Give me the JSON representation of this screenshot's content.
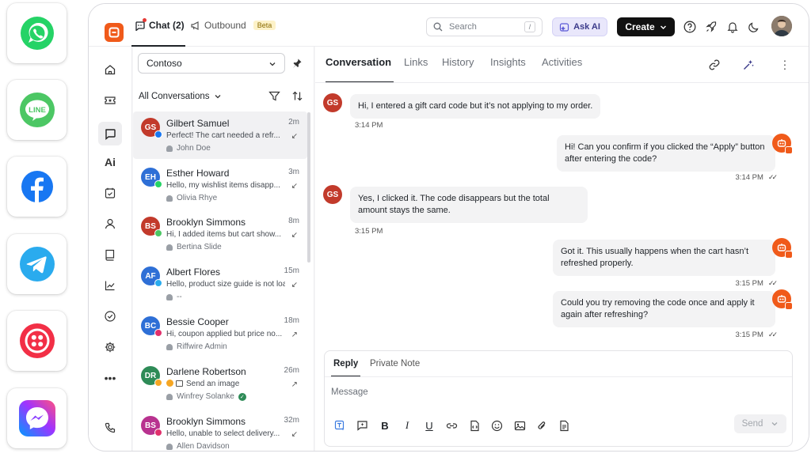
{
  "channels": [
    {
      "name": "WhatsApp",
      "icon": "whatsapp-icon",
      "color": "#25D366"
    },
    {
      "name": "LINE",
      "icon": "line-icon",
      "color": "#4CC764",
      "text": "LINE"
    },
    {
      "name": "Facebook",
      "icon": "facebook-icon",
      "color": "#1877F2"
    },
    {
      "name": "Telegram",
      "icon": "telegram-icon",
      "color": "#2AABEE"
    },
    {
      "name": "Twilio",
      "icon": "twilio-icon",
      "color": "#F22F46"
    },
    {
      "name": "Messenger",
      "icon": "messenger-icon",
      "color": "#A334FA"
    }
  ],
  "header": {
    "chat_tab": "Chat (2)",
    "outbound_tab": "Outbound",
    "beta_badge": "Beta",
    "search_placeholder": "Search",
    "search_shortcut": "/",
    "ask_ai": "Ask AI",
    "create": "Create"
  },
  "inbox": {
    "workspace": "Contoso",
    "filter": "All Conversations",
    "conversations": [
      {
        "initials": "GS",
        "name": "Gilbert Samuel",
        "time": "2m",
        "preview": "Perfect! The cart needed a refr...",
        "agent": "John Doe",
        "color": "#c23a2b",
        "channel_color": "#1877F2",
        "selected": true
      },
      {
        "initials": "EH",
        "name": "Esther Howard",
        "time": "3m",
        "preview": "Hello, my wishlist items disapp...",
        "agent": "Olivia Rhye",
        "color": "#2e6fd6",
        "channel_color": "#25D366"
      },
      {
        "initials": "BS",
        "name": "Brooklyn Simmons",
        "time": "8m",
        "preview": "Hi, I added items but cart show...",
        "agent": "Bertina Slide",
        "color": "#c23a2b",
        "channel_color": "#4CC764"
      },
      {
        "initials": "AF",
        "name": "Albert Flores",
        "time": "15m",
        "preview": "Hello, product size guide is not loa...",
        "agent": "--",
        "color": "#2e6fd6",
        "channel_color": "#2AABEE"
      },
      {
        "initials": "BC",
        "name": "Bessie Cooper",
        "time": "18m",
        "preview": "Hi, coupon applied but price no...",
        "agent": "Riffwire Admin",
        "color": "#2e6fd6",
        "channel_color": "#E1306C"
      },
      {
        "initials": "DR",
        "name": "Darlene Robertson",
        "time": "26m",
        "preview": "Send an image",
        "agent": "Winfrey Solanke",
        "color": "#2e8b57",
        "channel_color": "#F5A623"
      },
      {
        "initials": "BS",
        "name": "Brooklyn Simmons",
        "time": "32m",
        "preview": "Hello, unable to select delivery...",
        "agent": "Allen Davidson",
        "color": "#b8328f",
        "channel_color": "#E1306C"
      }
    ]
  },
  "tabs": [
    "Conversation",
    "Links",
    "History",
    "Insights",
    "Activities"
  ],
  "messages": [
    {
      "from": "customer",
      "initials": "GS",
      "text": "Hi, I entered a gift card code but it’s not applying to my order.",
      "time": "3:14 PM"
    },
    {
      "from": "bot",
      "text": "Hi! Can you confirm if you clicked the “Apply” button after entering the code?",
      "time": "3:14 PM"
    },
    {
      "from": "customer",
      "initials": "GS",
      "text": "Yes, I clicked it. The code disappears but the total amount stays the same.",
      "time": "3:15 PM"
    },
    {
      "from": "bot",
      "text": "Got it. This usually happens when the cart hasn’t refreshed properly.",
      "time": "3:15 PM"
    },
    {
      "from": "bot",
      "text": "Could you try removing the code once and apply it again after refreshing?",
      "time": "3:15 PM"
    }
  ],
  "composer": {
    "reply_tab": "Reply",
    "note_tab": "Private Note",
    "placeholder": "Message",
    "send": "Send"
  }
}
